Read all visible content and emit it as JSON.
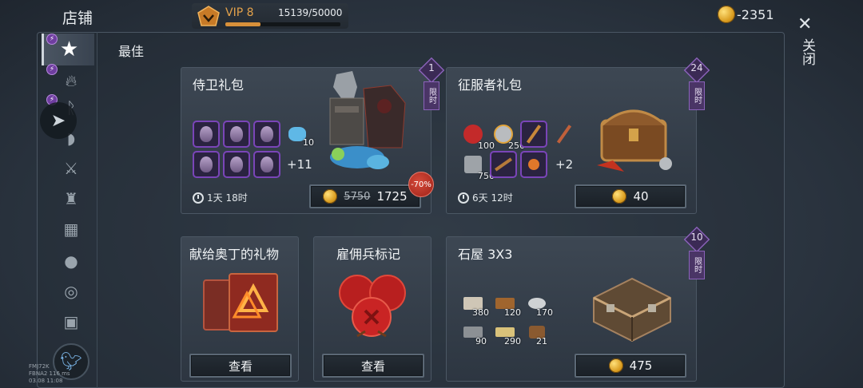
{
  "header": {
    "shop_title": "店铺",
    "vip_label": "VIP 8",
    "vip_progress": "15139/50000",
    "vip_progress_fraction": 0.303,
    "gold_total": "-2351"
  },
  "close": {
    "label": "关闭"
  },
  "sidebar": {
    "items": [
      {
        "icon": "star-icon"
      },
      {
        "icon": "fire-icon"
      },
      {
        "icon": "rune-icon"
      },
      {
        "icon": "dragon-icon"
      },
      {
        "icon": "axe-icon"
      },
      {
        "icon": "armor-icon"
      },
      {
        "icon": "bricks-icon"
      },
      {
        "icon": "bomb-icon"
      },
      {
        "icon": "coins-icon"
      },
      {
        "icon": "gift-icon"
      }
    ]
  },
  "debug": {
    "line1": "FMJ72K",
    "line2": "FBNA2 116 ms",
    "line3": "03.08 11:08"
  },
  "section": {
    "label": "最佳"
  },
  "cards": {
    "guard": {
      "title": "侍卫礼包",
      "limited_num": "1",
      "limited_tag": "限时",
      "item_count": "10",
      "more": "+11",
      "timer": "1天 18时",
      "old_price": "5750",
      "price": "1725",
      "discount": "-70%"
    },
    "conqueror": {
      "title": "征服者礼包",
      "limited_num": "24",
      "limited_tag": "限时",
      "counts": [
        "100",
        "250",
        "750"
      ],
      "more": "+2",
      "timer": "6天 12时",
      "price": "40"
    },
    "odin": {
      "title": "献给奥丁的礼物",
      "button": "查看"
    },
    "merc": {
      "title": "雇佣兵标记",
      "button": "查看"
    },
    "stone": {
      "title": "石屋 3X3",
      "limited_num": "10",
      "limited_tag": "限时",
      "counts": [
        "380",
        "120",
        "170",
        "90",
        "290",
        "21"
      ],
      "price": "475"
    }
  },
  "colors": {
    "accent_gold": "#e3a14a",
    "limited_purple": "#8a63b9",
    "discount_red": "#c8382b"
  }
}
